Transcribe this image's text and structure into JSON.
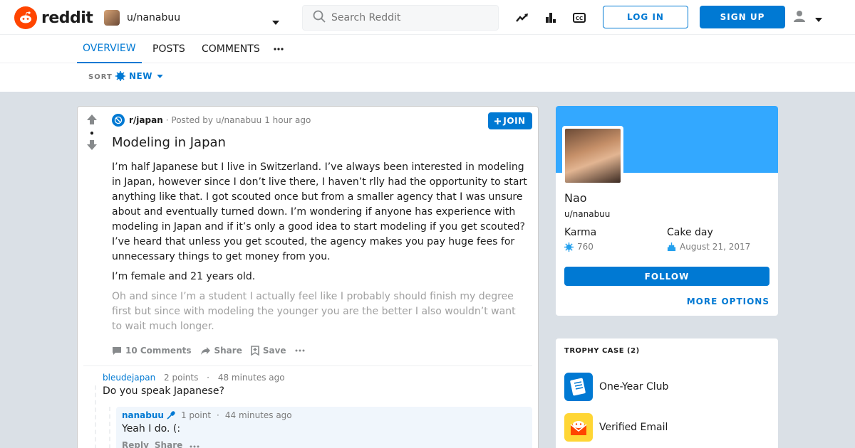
{
  "header": {
    "brand": "reddit",
    "current_user": "u/nanabuu",
    "search_placeholder": "Search Reddit",
    "login_label": "LOG IN",
    "signup_label": "SIGN UP"
  },
  "tabs": [
    {
      "label": "OVERVIEW",
      "active": true
    },
    {
      "label": "POSTS",
      "active": false
    },
    {
      "label": "COMMENTS",
      "active": false
    }
  ],
  "sort": {
    "label": "SORT",
    "value": "NEW"
  },
  "post": {
    "score": "•",
    "subreddit": "r/japan",
    "posted_by": "· Posted by u/nanabuu",
    "time": "1 hour ago",
    "join_label": "JOIN",
    "title": "Modeling in Japan",
    "paragraphs": [
      "I’m half Japanese but I live in Switzerland. I’ve always been interested in modeling in Japan, however since I don’t live there, I haven’t rlly had the opportunity to start anything like that. I got scouted once but from a smaller agency that I was unsure about and eventually turned down. I’m wondering if anyone has experience with modeling in Japan and if it’s only a good idea to start modeling if you get scouted? I’ve heard that unless you get scouted, the agency makes you pay huge fees for unnecessary things to get money from you.",
      "I’m female and 21 years old.",
      "Oh and since I’m a student I actually feel like I probably should finish my degree first but since with modeling the younger you are the better I also wouldn’t want to wait much longer."
    ],
    "comments_label": "10 Comments",
    "share_label": "Share",
    "save_label": "Save"
  },
  "comments": [
    {
      "author": "bleudejapan",
      "points": "2 points",
      "time": "48 minutes ago",
      "body": "Do you speak Japanese?"
    },
    {
      "author": "nanabuu",
      "points": "1 point",
      "time": "44 minutes ago",
      "body": "Yeah I do. (:",
      "reply_label": "Reply",
      "share_label": "Share"
    }
  ],
  "profile": {
    "display_name": "Nao",
    "handle": "u/nanabuu",
    "karma_label": "Karma",
    "karma_value": "760",
    "cakeday_label": "Cake day",
    "cakeday_value": "August 21, 2017",
    "follow_label": "FOLLOW",
    "more_options_label": "MORE OPTIONS"
  },
  "trophies": {
    "title": "TROPHY CASE (2)",
    "items": [
      {
        "name": "One-Year Club",
        "icon": "one-year-club-icon"
      },
      {
        "name": "Verified Email",
        "icon": "verified-email-icon"
      }
    ]
  },
  "colors": {
    "accent": "#0079d3",
    "brand": "#ff4500",
    "banner": "#33a8ff",
    "background": "#dae0e6"
  }
}
